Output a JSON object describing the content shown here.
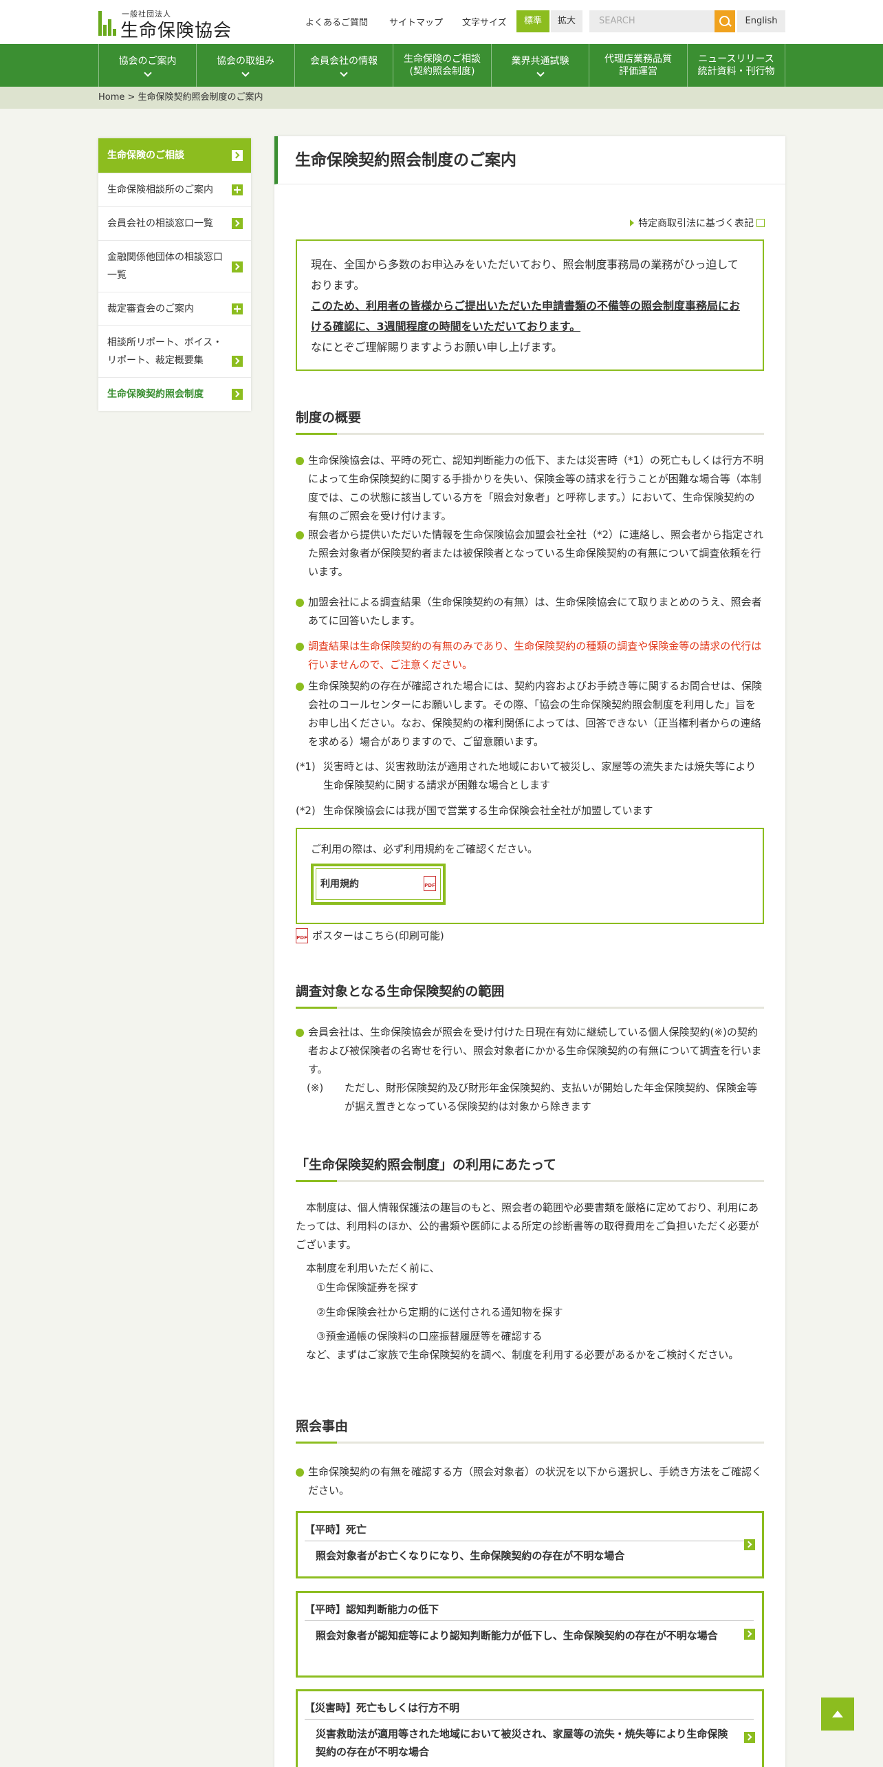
{
  "header": {
    "logo_small": "一般社団法人",
    "logo_name": "生命保険協会",
    "links": [
      "よくあるご質問",
      "サイトマップ"
    ],
    "font_size_label": "文字サイズ",
    "font_std": "標準",
    "font_large": "拡大",
    "search_placeholder": "SEARCH",
    "english": "English"
  },
  "nav": [
    {
      "l1": "協会のご案内",
      "l2": ""
    },
    {
      "l1": "協会の取組み",
      "l2": ""
    },
    {
      "l1": "会員会社の情報",
      "l2": ""
    },
    {
      "l1": "生命保険のご相談",
      "l2": "(契約照会制度)"
    },
    {
      "l1": "業界共通試験",
      "l2": ""
    },
    {
      "l1": "代理店業務品質",
      "l2": "評価運営"
    },
    {
      "l1": "ニュースリリース",
      "l2": "統計資料・刊行物"
    }
  ],
  "breadcrumb": "Home > 生命保険契約照会制度のご案内",
  "sidebar": {
    "heading": "生命保険のご相談",
    "items": [
      {
        "label": "生命保険相談所のご案内"
      },
      {
        "label": "会員会社の相談窓口一覧"
      },
      {
        "label": "金融関係他団体の相談窓口一覧"
      },
      {
        "label": "裁定審査会のご案内"
      },
      {
        "label": "相談所リポート、ボイス・リポート、裁定概要集"
      },
      {
        "label": "生命保険契約照会制度"
      }
    ]
  },
  "main": {
    "title": "生命保険契約照会制度のご案内",
    "commerce_link": "特定商取引法に基づく表記",
    "notice_line1": "現在、全国から多数のお申込みをいただいており、照会制度事務局の業務がひっ迫しております。",
    "notice_line2": "このため、利用者の皆様からご提出いただいた申請書類の不備等の照会制度事務局における確認に、3週間程度の時間をいただいております。",
    "notice_line3": "なにとぞご理解賜りますようお願い申し上げます。",
    "s1_title": "制度の概要",
    "s1_bullets": [
      "生命保険協会は、平時の死亡、認知判断能力の低下、または災害時（*1）の死亡もしくは行方不明によって生命保険契約に関する手掛かりを失い、保険金等の請求を行うことが困難な場合等（本制度では、この状態に該当している方を「照会対象者」と呼称します。）において、生命保険契約の有無のご照会を受け付けます。",
      "照会者から提供いただいた情報を生命保険協会加盟会社全社（*2）に連絡し、照会者から指定された照会対象者が保険契約者または被保険者となっている生命保険契約の有無について調査依頼を行います。",
      "加盟会社による調査結果（生命保険契約の有無）は、生命保険協会にて取りまとめのうえ、照会者あてに回答いたします。",
      "調査結果は生命保険契約の有無のみであり、生命保険契約の種類の調査や保険金等の請求の代行は行いませんので、ご注意ください。",
      "生命保険契約の存在が確認された場合には、契約内容およびお手続き等に関するお問合せは、保険会社のコールセンターにお願いします。その際、「協会の生命保険契約照会制度を利用した」旨をお申し出ください。なお、保険契約の権利関係によっては、回答できない（正当権利者からの連絡を求める）場合がありますので、ご留意願います。"
    ],
    "s1_notes": [
      {
        "key": "(*1)",
        "text": "災害時とは、災害救助法が適用された地域において被災し、家屋等の流失または焼失等により生命保険契約に関する請求が困難な場合とします"
      },
      {
        "key": "(*2)",
        "text": "生命保険協会には我が国で営業する生命保険会社全社が加盟しています"
      }
    ],
    "terms_text": "ご利用の際は、必ず利用規約をご確認ください。",
    "terms_button": "利用規約",
    "poster_link": "ポスターはこちら(印刷可能)",
    "s2_title": "調査対象となる生命保険契約の範囲",
    "s2_bullet": "会員会社は、生命保険協会が照会を受け付けた日現在有効に継続している個人保険契約(※)の契約者および被保険者の名寄せを行い、照会対象者にかかる生命保険契約の有無について調査を行います。",
    "s2_note_key": "(※)",
    "s2_note": "ただし、財形保険契約及び財形年金保険契約、支払いが開始した年金保険契約、保険金等が据え置きとなっている保険契約は対象から除きます",
    "s3_title": "「生命保険契約照会制度」の利用にあたって",
    "s3_para": "本制度は、個人情報保護法の趣旨のもと、照会者の範囲や必要書類を厳格に定めており、利用にあたっては、利用料のほか、公的書類や医師による所定の診断書等の取得費用をご負担いただく必要がございます。",
    "s3_intro": "本制度を利用いただく前に、",
    "s3_steps": [
      "①生命保険証券を探す",
      "②生命保険会社から定期的に送付される通知物を探す",
      "③預金通帳の保険料の口座振替履歴等を確認する"
    ],
    "s3_close": "など、まずはご家族で生命保険契約を調べ、制度を利用する必要があるかをご検討ください。",
    "s4_title": "照会事由",
    "s4_bullet": "生命保険契約の有無を確認する方（照会対象者）の状況を以下から選択し、手続き方法をご確認ください。",
    "cards": [
      {
        "title": "【平時】死亡",
        "body": "照会対象者がお亡くなりになり、生命保険契約の存在が不明な場合"
      },
      {
        "title": "【平時】認知判断能力の低下",
        "body": "照会対象者が認知症等により認知判断能力が低下し、生命保険契約の存在が不明な場合"
      },
      {
        "title": "【災害時】死亡もしくは行方不明",
        "body": "災害救助法が適用等された地域において被災され、家屋等の流失・焼失等により生命保険契約の存在が不明な場合"
      }
    ]
  },
  "colors": {
    "green": "#3b8f32",
    "lime": "#8cbd1f",
    "orange": "#f0a21e",
    "red": "#e23a1d"
  }
}
